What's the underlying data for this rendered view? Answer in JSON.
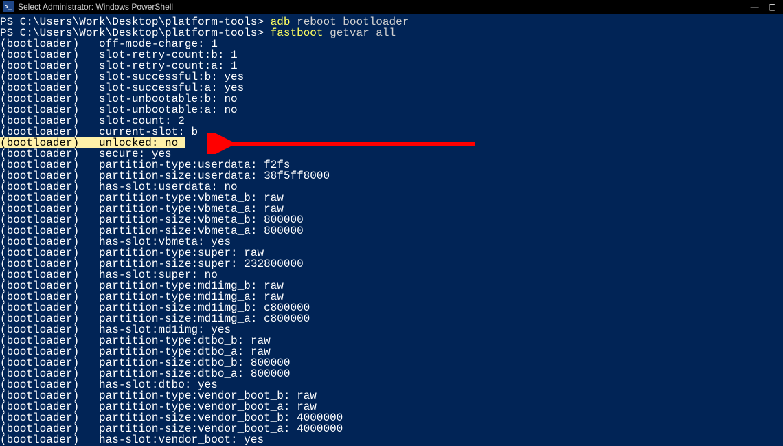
{
  "window": {
    "title": "Select Administrator: Windows PowerShell",
    "icon_text": ">_"
  },
  "prompt1": {
    "ps_path": "PS C:\\Users\\Work\\Desktop\\platform-tools>",
    "cmd_word": "adb",
    "cmd_rest": " reboot bootloader"
  },
  "prompt2": {
    "ps_path": "PS C:\\Users\\Work\\Desktop\\platform-tools>",
    "cmd_word": "fastboot",
    "cmd_rest": " getvar all"
  },
  "lines": [
    "(bootloader)   off-mode-charge: 1",
    "(bootloader)   slot-retry-count:b: 1",
    "(bootloader)   slot-retry-count:a: 1",
    "(bootloader)   slot-successful:b: yes",
    "(bootloader)   slot-successful:a: yes",
    "(bootloader)   slot-unbootable:b: no",
    "(bootloader)   slot-unbootable:a: no",
    "(bootloader)   slot-count: 2",
    "(bootloader)   current-slot: b"
  ],
  "highlighted_line": "(bootloader)   unlocked: no ",
  "lines_after": [
    "(bootloader)   secure: yes",
    "(bootloader)   partition-type:userdata: f2fs",
    "(bootloader)   partition-size:userdata: 38f5ff8000",
    "(bootloader)   has-slot:userdata: no",
    "(bootloader)   partition-type:vbmeta_b: raw",
    "(bootloader)   partition-type:vbmeta_a: raw",
    "(bootloader)   partition-size:vbmeta_b: 800000",
    "(bootloader)   partition-size:vbmeta_a: 800000",
    "(bootloader)   has-slot:vbmeta: yes",
    "(bootloader)   partition-type:super: raw",
    "(bootloader)   partition-size:super: 232800000",
    "(bootloader)   has-slot:super: no",
    "(bootloader)   partition-type:md1img_b: raw",
    "(bootloader)   partition-type:md1img_a: raw",
    "(bootloader)   partition-size:md1img_b: c800000",
    "(bootloader)   partition-size:md1img_a: c800000",
    "(bootloader)   has-slot:md1img: yes",
    "(bootloader)   partition-type:dtbo_b: raw",
    "(bootloader)   partition-type:dtbo_a: raw",
    "(bootloader)   partition-size:dtbo_b: 800000",
    "(bootloader)   partition-size:dtbo_a: 800000",
    "(bootloader)   has-slot:dtbo: yes",
    "(bootloader)   partition-type:vendor_boot_b: raw",
    "(bootloader)   partition-type:vendor_boot_a: raw",
    "(bootloader)   partition-size:vendor_boot_b: 4000000",
    "(bootloader)   partition-size:vendor_boot_a: 4000000",
    "(bootloader)   has-slot:vendor_boot: yes"
  ],
  "arrow_color": "#ff0000"
}
